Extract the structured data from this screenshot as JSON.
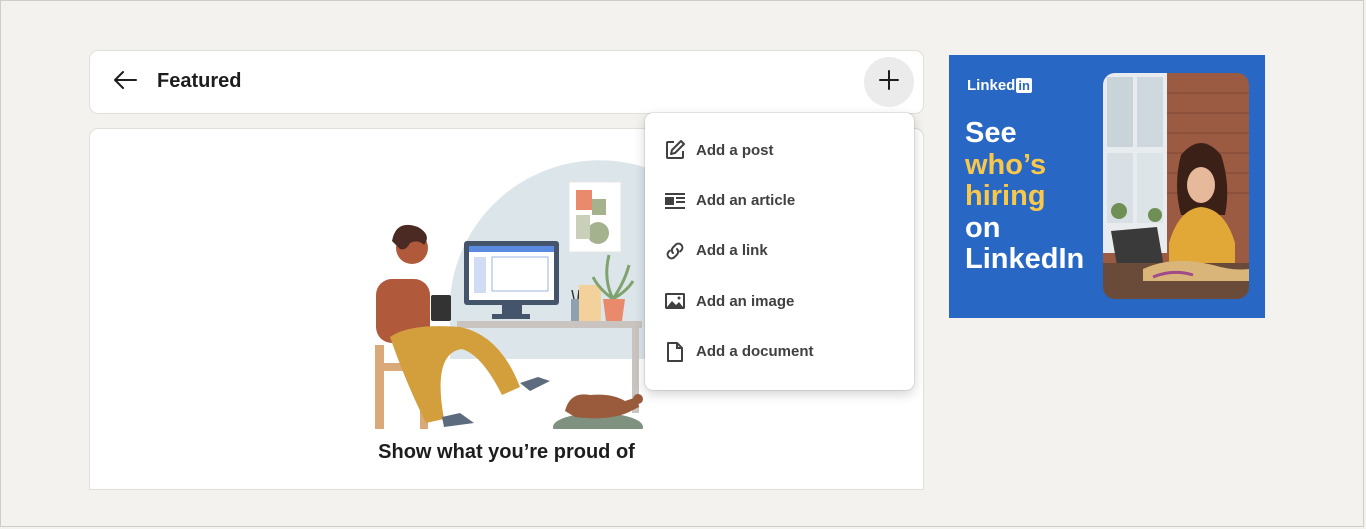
{
  "header": {
    "title": "Featured",
    "back_icon": "arrow-left-icon",
    "add_icon": "plus-icon"
  },
  "menu": {
    "items": [
      {
        "label": "Add a post",
        "icon": "pencil-square-icon"
      },
      {
        "label": "Add an article",
        "icon": "article-icon"
      },
      {
        "label": "Add a link",
        "icon": "link-icon"
      },
      {
        "label": "Add an image",
        "icon": "image-icon"
      },
      {
        "label": "Add a document",
        "icon": "document-icon"
      }
    ]
  },
  "empty_state": {
    "title": "Show what you’re proud of"
  },
  "ad": {
    "logo_text": "Linked",
    "logo_in": "in",
    "line1": "See",
    "line2": "who’s",
    "line3": "hiring",
    "line4": "on",
    "line5": "LinkedIn",
    "colors": {
      "background": "#2867c4",
      "highlight": "#f8c84a"
    }
  }
}
